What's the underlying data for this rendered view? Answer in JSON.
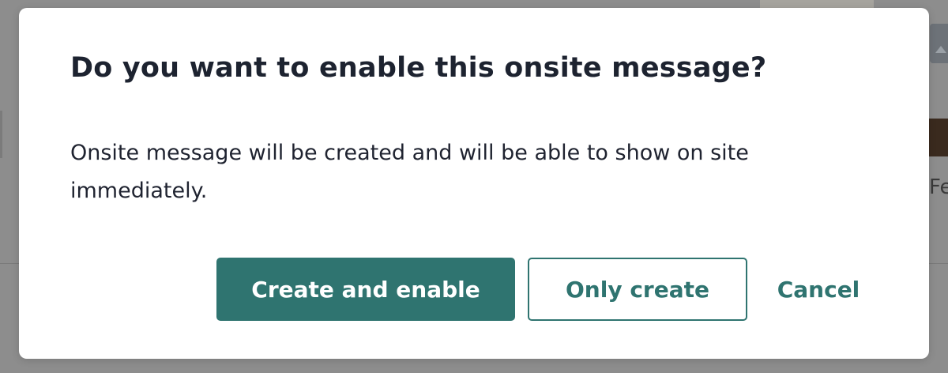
{
  "dialog": {
    "title": "Do you want to enable this onsite message?",
    "body": "Onsite message will be created and will be able to show on site immediately.",
    "buttons": {
      "primary_label": "Create and enable",
      "secondary_label": "Only create",
      "cancel_label": "Cancel"
    }
  },
  "background": {
    "text_fragment": "Fer",
    "scroll_icon": "chevron-up-icon"
  },
  "colors": {
    "accent": "#2f7470",
    "title_text": "#1d2330",
    "overlay": "#8d8d8d"
  }
}
